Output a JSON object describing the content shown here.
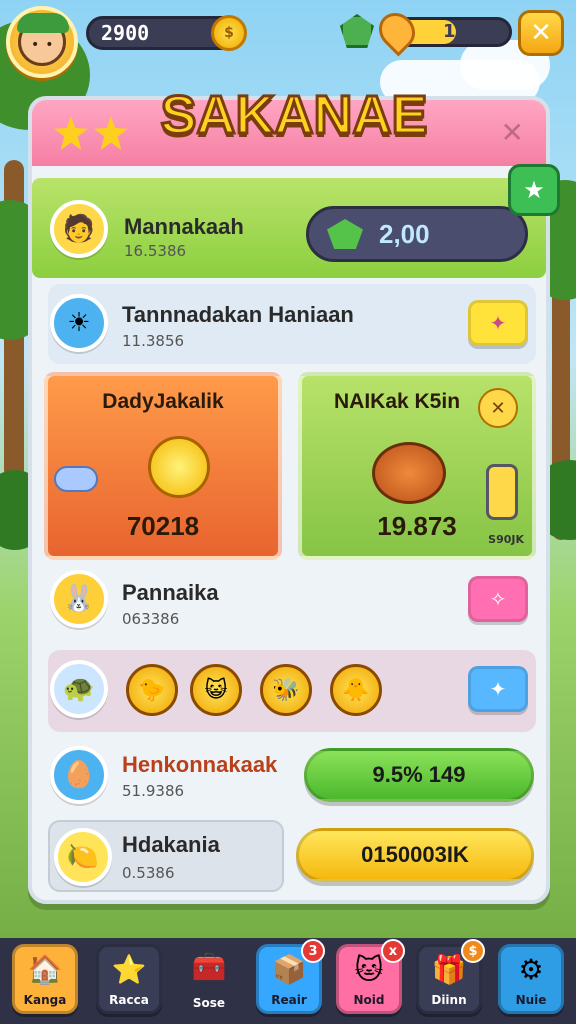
{
  "hud": {
    "coins": "2900",
    "coin_symbol": "$",
    "energy_value": "1",
    "energy_fraction": 0.55,
    "close_symbol": "✕"
  },
  "panel": {
    "title": "SAKANAE",
    "close_symbol": "✕",
    "profile": {
      "name": "Mannakaah",
      "sub": "16.5386",
      "gem_value": "2,00"
    },
    "task": {
      "name": "Tannnadakan Haniaan",
      "sub": "11.3856"
    },
    "card_left": {
      "title": "DadyJakalik",
      "value": "70218"
    },
    "card_right": {
      "title": "NAIKak K5in",
      "value": "19.873",
      "tag": "S90JK"
    },
    "pet_row": {
      "name": "Pannaika",
      "sub": "063386"
    },
    "hero_row": {
      "name": "Henkonnakaak",
      "sub": "51.9386",
      "button": "9.5% 149"
    },
    "last_row": {
      "name": "Hdakania",
      "sub": "0.5386",
      "button": "0150003IK"
    }
  },
  "nav": [
    {
      "label": "Kanga",
      "icon": "home-icon",
      "color": "#ffb23a"
    },
    {
      "label": "Racca",
      "icon": "star-icon",
      "color": "#3a3d56"
    },
    {
      "label": "Sose",
      "icon": "treasure-icon",
      "color": "#2f3147"
    },
    {
      "label": "Reair",
      "icon": "box-icon",
      "color": "#36a7ff",
      "badge": "3"
    },
    {
      "label": "Noid",
      "icon": "cat-icon",
      "color": "#ff6fa3",
      "badge": "x"
    },
    {
      "label": "Diinn",
      "icon": "chest-icon",
      "color": "#3a3d56",
      "badge": "$"
    },
    {
      "label": "Nuie",
      "icon": "gear-icon",
      "color": "#2f9ce6"
    }
  ],
  "colors": {
    "accent": "#ffd21f",
    "pink": "#f57fa4",
    "green": "#5bc43a",
    "orange": "#f08a3a"
  }
}
